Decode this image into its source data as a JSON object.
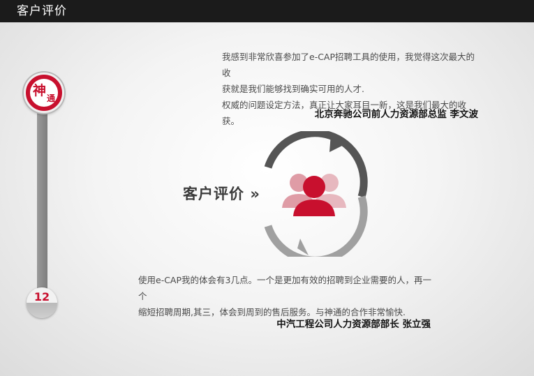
{
  "header": {
    "title": "客户评价"
  },
  "timeline": {
    "brand_char_1": "神",
    "brand_char_2": "通",
    "page_number": "12"
  },
  "center": {
    "label": "客户评价",
    "chevron": "»",
    "icon": "users-group-icon"
  },
  "testimonials": [
    {
      "lines": [
        "我感到非常欣喜参加了e-CAP招聘工具的使用，我觉得这次最大的收",
        "获就是我们能够找到确实可用的人才.",
        "权威的问题设定方法，真正让大家耳目一新，这是我们最大的收获。"
      ],
      "author": "北京奔驰公司前人力资源部总监 李文波"
    },
    {
      "lines": [
        "使用e-CAP我的体会有3几点。一个是更加有效的招聘到企业需要的人，再一个",
        "缩短招聘周期,其三，体会到周到的售后服务。与神通的合作非常愉快."
      ],
      "author": "中汽工程公司人力资源部部长 张立强"
    }
  ],
  "colors": {
    "accent": "#c8102e",
    "accent_light": "#d98b96",
    "header_bg": "#1b1b1b",
    "ring_dark": "#555555",
    "ring_light": "#a0a0a0"
  }
}
